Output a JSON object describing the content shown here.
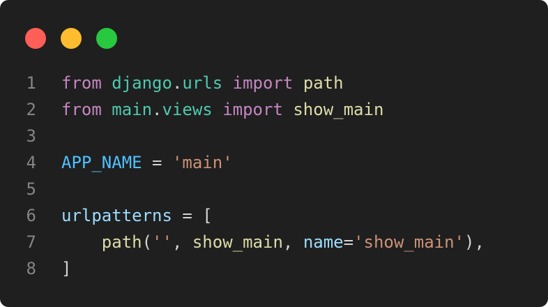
{
  "window": {
    "controls": [
      {
        "name": "close",
        "color": "#ff5f57"
      },
      {
        "name": "minimize",
        "color": "#febc2e"
      },
      {
        "name": "maximize",
        "color": "#28c840"
      }
    ]
  },
  "code": {
    "lines": [
      {
        "number": "1",
        "tokens": [
          {
            "text": "from",
            "type": "kw"
          },
          {
            "text": " ",
            "type": "plain"
          },
          {
            "text": "django",
            "type": "mod"
          },
          {
            "text": ".",
            "type": "plain"
          },
          {
            "text": "urls",
            "type": "mod"
          },
          {
            "text": " ",
            "type": "plain"
          },
          {
            "text": "import",
            "type": "kw"
          },
          {
            "text": " ",
            "type": "plain"
          },
          {
            "text": "path",
            "type": "fn"
          }
        ]
      },
      {
        "number": "2",
        "tokens": [
          {
            "text": "from",
            "type": "kw"
          },
          {
            "text": " ",
            "type": "plain"
          },
          {
            "text": "main",
            "type": "mod"
          },
          {
            "text": ".",
            "type": "plain"
          },
          {
            "text": "views",
            "type": "mod"
          },
          {
            "text": " ",
            "type": "plain"
          },
          {
            "text": "import",
            "type": "kw"
          },
          {
            "text": " ",
            "type": "plain"
          },
          {
            "text": "show_main",
            "type": "fn"
          }
        ]
      },
      {
        "number": "3",
        "tokens": []
      },
      {
        "number": "4",
        "tokens": [
          {
            "text": "APP_NAME",
            "type": "var"
          },
          {
            "text": " = ",
            "type": "plain"
          },
          {
            "text": "'main'",
            "type": "str"
          }
        ]
      },
      {
        "number": "5",
        "tokens": []
      },
      {
        "number": "6",
        "tokens": [
          {
            "text": "urlpatterns",
            "type": "param"
          },
          {
            "text": " = [",
            "type": "plain"
          }
        ]
      },
      {
        "number": "7",
        "tokens": [
          {
            "text": "    ",
            "type": "plain"
          },
          {
            "text": "path",
            "type": "fn"
          },
          {
            "text": "(",
            "type": "plain"
          },
          {
            "text": "''",
            "type": "str"
          },
          {
            "text": ", ",
            "type": "plain"
          },
          {
            "text": "show_main",
            "type": "fn"
          },
          {
            "text": ", ",
            "type": "plain"
          },
          {
            "text": "name",
            "type": "param"
          },
          {
            "text": "=",
            "type": "plain"
          },
          {
            "text": "'show_main'",
            "type": "str"
          },
          {
            "text": "),",
            "type": "plain"
          }
        ]
      },
      {
        "number": "8",
        "tokens": [
          {
            "text": "]",
            "type": "plain"
          }
        ]
      }
    ]
  }
}
